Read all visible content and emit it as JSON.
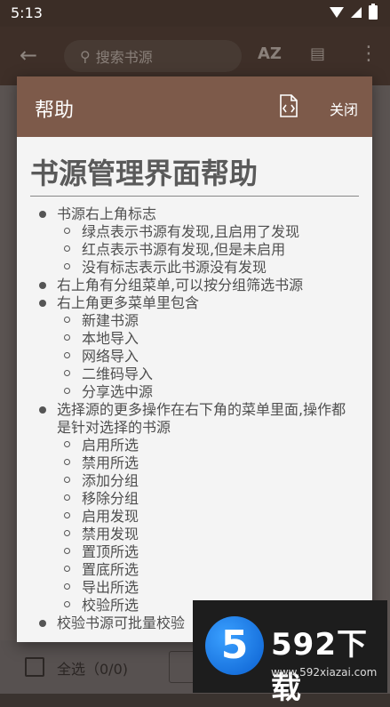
{
  "status_bar": {
    "time": "5:13"
  },
  "app_bar": {
    "search_placeholder": "搜索书源",
    "sort_label": "AZ"
  },
  "dialog": {
    "title": "帮助",
    "close_label": "关闭",
    "heading": "书源管理界面帮助",
    "items": [
      {
        "text": "书源右上角标志",
        "level": 1
      },
      {
        "text": "绿点表示书源有发现,且启用了发现",
        "level": 2
      },
      {
        "text": "红点表示书源有发现,但是未启用",
        "level": 2
      },
      {
        "text": "没有标志表示此书源没有发现",
        "level": 2
      },
      {
        "text": "右上角有分组菜单,可以按分组筛选书源",
        "level": 1
      },
      {
        "text": "右上角更多菜单里包含",
        "level": 1
      },
      {
        "text": "新建书源",
        "level": 2
      },
      {
        "text": "本地导入",
        "level": 2
      },
      {
        "text": "网络导入",
        "level": 2
      },
      {
        "text": "二维码导入",
        "level": 2
      },
      {
        "text": "分享选中源",
        "level": 2
      },
      {
        "text": "选择源的更多操作在右下角的菜单里面,操作都是针对选择的书源",
        "level": 1
      },
      {
        "text": "启用所选",
        "level": 2
      },
      {
        "text": "禁用所选",
        "level": 2
      },
      {
        "text": "添加分组",
        "level": 2
      },
      {
        "text": "移除分组",
        "level": 2
      },
      {
        "text": "启用发现",
        "level": 2
      },
      {
        "text": "禁用发现",
        "level": 2
      },
      {
        "text": "置顶所选",
        "level": 2
      },
      {
        "text": "置底所选",
        "level": 2
      },
      {
        "text": "导出所选",
        "level": 2
      },
      {
        "text": "校验所选",
        "level": 2
      },
      {
        "text": "校验书源可批量校验",
        "level": 1
      }
    ]
  },
  "bottom_bar": {
    "select_all_label": "全选（0/0)"
  },
  "watermark": {
    "logo_text": "5",
    "brand": "592下载",
    "url": "www.592xiazai.com"
  },
  "colors": {
    "dialog_header": "#7d5a4a",
    "dialog_bg": "#f4f4f4",
    "status_bar": "#3b2d26"
  }
}
